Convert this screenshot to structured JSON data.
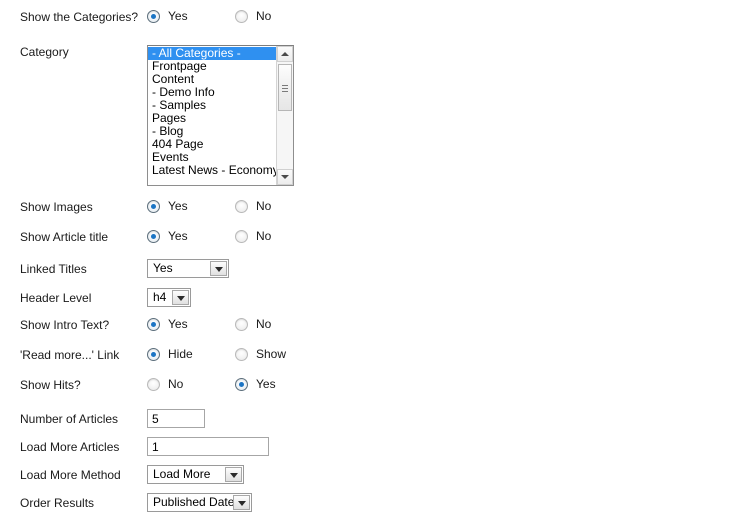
{
  "form": {
    "rows": [
      {
        "id": "show-the-categories",
        "label": "Show the Categories?",
        "type": "radio",
        "options": [
          {
            "label": "Yes",
            "checked": true
          },
          {
            "label": "No",
            "checked": false
          }
        ]
      },
      {
        "id": "category",
        "label": "Category",
        "type": "listbox",
        "items": [
          {
            "label": "- All Categories -",
            "selected": true
          },
          {
            "label": "Frontpage",
            "selected": false
          },
          {
            "label": "Content",
            "selected": false
          },
          {
            "label": "- Demo Info",
            "selected": false
          },
          {
            "label": "- Samples",
            "selected": false
          },
          {
            "label": "Pages",
            "selected": false
          },
          {
            "label": "- Blog",
            "selected": false
          },
          {
            "label": "404 Page",
            "selected": false
          },
          {
            "label": "Events",
            "selected": false
          },
          {
            "label": "Latest News - Economy",
            "selected": false
          }
        ]
      },
      {
        "id": "show-images",
        "label": "Show Images",
        "type": "radio",
        "options": [
          {
            "label": "Yes",
            "checked": true
          },
          {
            "label": "No",
            "checked": false
          }
        ]
      },
      {
        "id": "show-article-title",
        "label": "Show Article title",
        "type": "radio",
        "options": [
          {
            "label": "Yes",
            "checked": true
          },
          {
            "label": "No",
            "checked": false
          }
        ]
      },
      {
        "id": "linked-titles",
        "label": "Linked Titles",
        "type": "select",
        "value": "Yes"
      },
      {
        "id": "header-level",
        "label": "Header Level",
        "type": "select",
        "value": "h4"
      },
      {
        "id": "show-intro-text",
        "label": "Show Intro Text?",
        "type": "radio",
        "options": [
          {
            "label": "Yes",
            "checked": true
          },
          {
            "label": "No",
            "checked": false
          }
        ]
      },
      {
        "id": "read-more-link",
        "label": "'Read more...' Link",
        "type": "radio",
        "options": [
          {
            "label": "Hide",
            "checked": true
          },
          {
            "label": "Show",
            "checked": false
          }
        ]
      },
      {
        "id": "show-hits",
        "label": "Show Hits?",
        "type": "radio",
        "options": [
          {
            "label": "No",
            "checked": false
          },
          {
            "label": "Yes",
            "checked": true
          }
        ]
      },
      {
        "id": "number-of-articles",
        "label": "Number of Articles",
        "type": "text",
        "value": "5"
      },
      {
        "id": "load-more-articles",
        "label": "Load More Articles",
        "type": "text",
        "value": "1"
      },
      {
        "id": "load-more-method",
        "label": "Load More Method",
        "type": "select",
        "value": "Load More"
      },
      {
        "id": "order-results",
        "label": "Order Results",
        "type": "select",
        "value": "Published Date"
      }
    ]
  },
  "colors": {
    "selection_blue": "#2f90f0",
    "radio_dot_blue": "#1b74c4",
    "background": "#ffffff"
  }
}
